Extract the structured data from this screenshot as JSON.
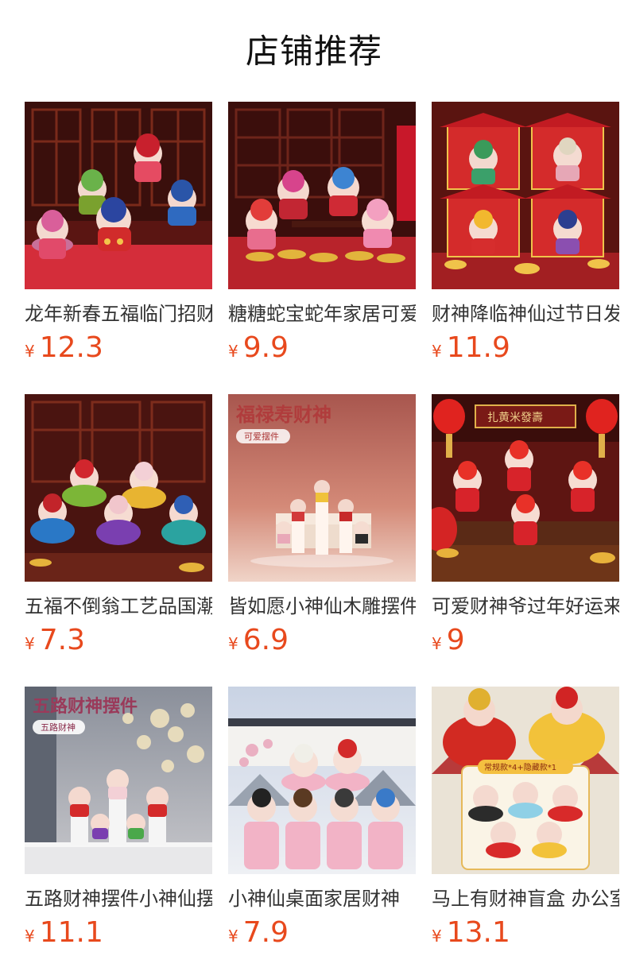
{
  "header": {
    "title": "店铺推荐"
  },
  "currency": "¥",
  "products": [
    {
      "name": "龙年新春五福临门招财",
      "price": "12.3",
      "image": "five-fortune-figurines-red-room"
    },
    {
      "name": "糖糖蛇宝蛇年家居可爱",
      "price": "9.9",
      "image": "snake-baby-figurines-gold-coins"
    },
    {
      "name": "财神降临神仙过节日发",
      "price": "11.9",
      "image": "god-of-wealth-red-pavilions"
    },
    {
      "name": "五福不倒翁工艺品国潮",
      "price": "7.3",
      "image": "tumbler-figurines-colored-bowls"
    },
    {
      "name": "皆如愿小神仙木雕摆件",
      "price": "6.9",
      "image": "fu-lu-shou-figurines-pink-backdrop",
      "overlay_title": "福禄寿财神",
      "overlay_tag": "可爱摆件"
    },
    {
      "name": "可爱财神爷过年好运来",
      "price": "9",
      "image": "god-of-wealth-lanterns-stage",
      "overlay_sign": "扎黄米發壽"
    },
    {
      "name": "五路财神摆件小神仙摆",
      "price": "11.1",
      "image": "five-road-gods-blossom-tree",
      "overlay_title": "五路财神摆件",
      "overlay_tag": "五路财神"
    },
    {
      "name": "小神仙桌面家居财神",
      "price": "7.9",
      "image": "little-gods-lotus-pedestals"
    },
    {
      "name": "马上有财神盲盒 办公室",
      "price": "13.1",
      "image": "god-of-wealth-blind-box-horse",
      "overlay_tag": "常规款*4+隐藏款*1"
    }
  ]
}
